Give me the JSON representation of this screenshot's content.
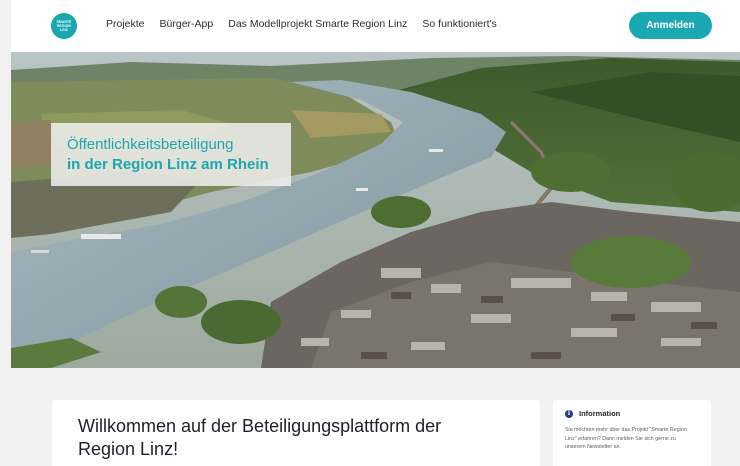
{
  "logo": {
    "lines": [
      "SMARTE",
      "REGION",
      "LINZ"
    ]
  },
  "nav": {
    "items": [
      {
        "label": "Projekte"
      },
      {
        "label": "Bürger-App"
      },
      {
        "label": "Das Modellprojekt Smarte Region Linz"
      },
      {
        "label": "So funktioniert's"
      }
    ],
    "login_label": "Anmelden"
  },
  "hero": {
    "title_line1": "Öffentlichkeitsbeteiligung",
    "title_line2": "in der Region Linz am Rhein"
  },
  "welcome": {
    "heading": "Willkommen auf der Beteiligungsplattform der Region Linz!"
  },
  "info": {
    "icon": "info-icon",
    "title": "Information",
    "text": "Sie möchten mehr über das Projekt \"Smarte Region Linz\" erfahren? Dann melden Sie sich gerne zu unserem Newsletter an."
  },
  "colors": {
    "accent": "#1aa9b3",
    "river": "#8fa7b2",
    "forest": "#3f5f2e"
  }
}
